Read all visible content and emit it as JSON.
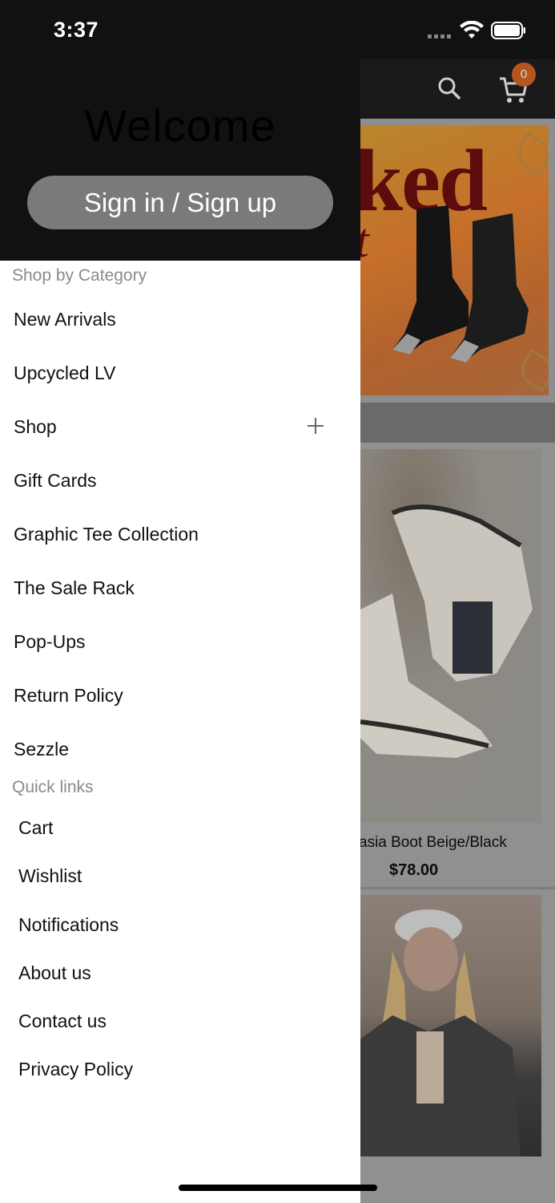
{
  "status_bar": {
    "time": "3:37"
  },
  "background_app": {
    "cart_count": "0",
    "banner_text": "ked",
    "banner_subtext": "t",
    "product_name": "asia Boot Beige/Black",
    "product_price": "$78.00"
  },
  "drawer": {
    "welcome_title": "Welcome",
    "signin_label": "Sign in / Sign up",
    "category_section_label": "Shop by Category",
    "categories": [
      {
        "label": "New Arrivals"
      },
      {
        "label": "Upcycled LV"
      },
      {
        "label": "Shop"
      },
      {
        "label": "Gift Cards"
      },
      {
        "label": "Graphic Tee Collection"
      },
      {
        "label": "The Sale Rack"
      },
      {
        "label": "Pop-Ups"
      },
      {
        "label": "Return Policy"
      },
      {
        "label": "Sezzle"
      }
    ],
    "quick_links_label": "Quick links",
    "quick_links": [
      {
        "label": "Cart"
      },
      {
        "label": "Wishlist"
      },
      {
        "label": "Notifications"
      },
      {
        "label": "About us"
      },
      {
        "label": "Contact us"
      },
      {
        "label": "Privacy Policy"
      }
    ]
  },
  "icons": {
    "search": "search-icon",
    "cart": "cart-icon",
    "expand": "plus-icon",
    "wifi": "wifi-icon",
    "battery": "battery-icon",
    "signal": "signal-icon"
  },
  "colors": {
    "drawer_header_bg": "#111111",
    "signin_button_bg": "#7a7a7a",
    "cart_badge_bg": "#b5561f",
    "section_label": "#8a8a8a"
  }
}
